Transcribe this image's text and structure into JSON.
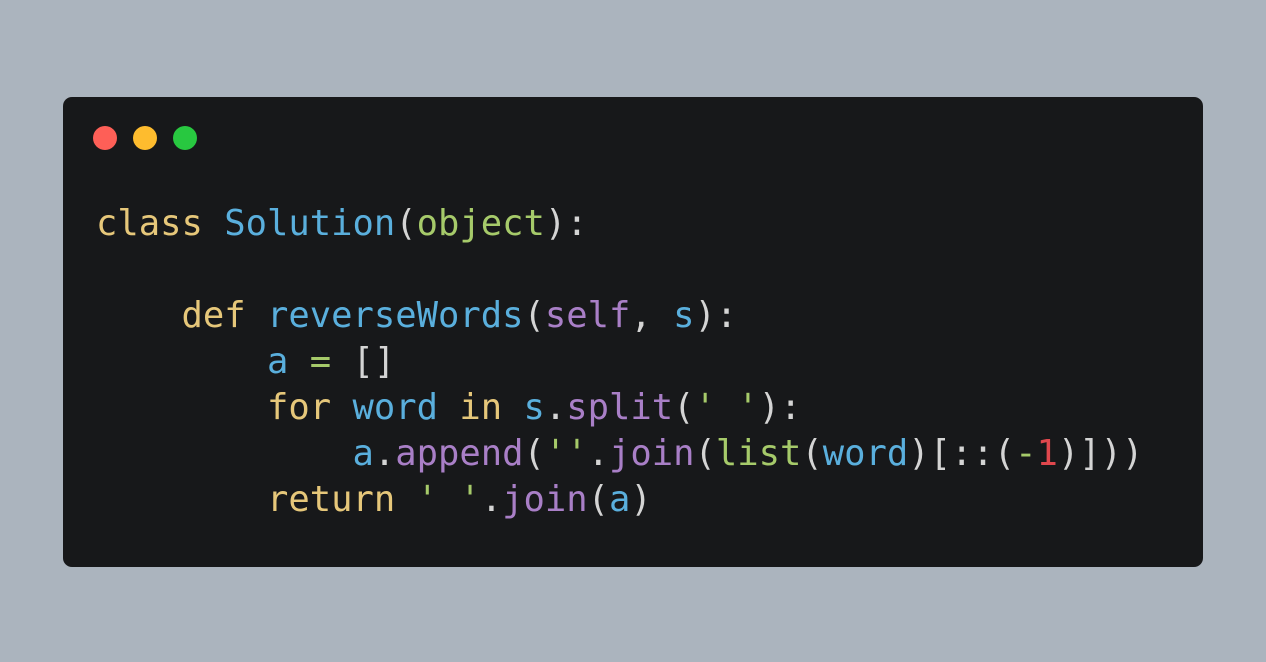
{
  "colors": {
    "background": "#abb4be",
    "editor_background": "#17181a",
    "window_close": "#fe5f57",
    "window_minimize": "#febc2e",
    "window_maximize": "#28c840",
    "keyword": "#e6c77a",
    "identifier": "#5aafdd",
    "builtin": "#a6ca6a",
    "method": "#a97fc7",
    "number": "#e0474d",
    "punctuation": "#d4d4d4"
  },
  "window_controls": [
    "close-dot",
    "minimize-dot",
    "maximize-dot"
  ],
  "code": {
    "language": "python",
    "lines": [
      [
        {
          "t": "class",
          "k": "kw"
        },
        {
          "t": " ",
          "k": "p"
        },
        {
          "t": "Solution",
          "k": "cls"
        },
        {
          "t": "(",
          "k": "p"
        },
        {
          "t": "object",
          "k": "bi"
        },
        {
          "t": "):",
          "k": "p"
        }
      ],
      [],
      [
        {
          "t": "    ",
          "k": "p"
        },
        {
          "t": "def",
          "k": "kw"
        },
        {
          "t": " ",
          "k": "p"
        },
        {
          "t": "reverseWords",
          "k": "fn"
        },
        {
          "t": "(",
          "k": "p"
        },
        {
          "t": "self",
          "k": "self"
        },
        {
          "t": ", ",
          "k": "p"
        },
        {
          "t": "s",
          "k": "id"
        },
        {
          "t": "):",
          "k": "p"
        }
      ],
      [
        {
          "t": "        ",
          "k": "p"
        },
        {
          "t": "a",
          "k": "id"
        },
        {
          "t": " ",
          "k": "p"
        },
        {
          "t": "=",
          "k": "op"
        },
        {
          "t": " []",
          "k": "p"
        }
      ],
      [
        {
          "t": "        ",
          "k": "p"
        },
        {
          "t": "for",
          "k": "kw"
        },
        {
          "t": " ",
          "k": "p"
        },
        {
          "t": "word",
          "k": "id"
        },
        {
          "t": " ",
          "k": "p"
        },
        {
          "t": "in",
          "k": "kw"
        },
        {
          "t": " ",
          "k": "p"
        },
        {
          "t": "s",
          "k": "id"
        },
        {
          "t": ".",
          "k": "p"
        },
        {
          "t": "split",
          "k": "meth"
        },
        {
          "t": "(",
          "k": "p"
        },
        {
          "t": "' '",
          "k": "str"
        },
        {
          "t": "):",
          "k": "p"
        }
      ],
      [
        {
          "t": "            ",
          "k": "p"
        },
        {
          "t": "a",
          "k": "id"
        },
        {
          "t": ".",
          "k": "p"
        },
        {
          "t": "append",
          "k": "meth"
        },
        {
          "t": "(",
          "k": "p"
        },
        {
          "t": "''",
          "k": "str"
        },
        {
          "t": ".",
          "k": "p"
        },
        {
          "t": "join",
          "k": "meth"
        },
        {
          "t": "(",
          "k": "p"
        },
        {
          "t": "list",
          "k": "bi"
        },
        {
          "t": "(",
          "k": "p"
        },
        {
          "t": "word",
          "k": "id"
        },
        {
          "t": ")[::(",
          "k": "p"
        },
        {
          "t": "-",
          "k": "op"
        },
        {
          "t": "1",
          "k": "num"
        },
        {
          "t": ")]))",
          "k": "p"
        }
      ],
      [
        {
          "t": "        ",
          "k": "p"
        },
        {
          "t": "return",
          "k": "kw"
        },
        {
          "t": " ",
          "k": "p"
        },
        {
          "t": "' '",
          "k": "str"
        },
        {
          "t": ".",
          "k": "p"
        },
        {
          "t": "join",
          "k": "meth"
        },
        {
          "t": "(",
          "k": "p"
        },
        {
          "t": "a",
          "k": "id"
        },
        {
          "t": ")",
          "k": "p"
        }
      ]
    ]
  }
}
